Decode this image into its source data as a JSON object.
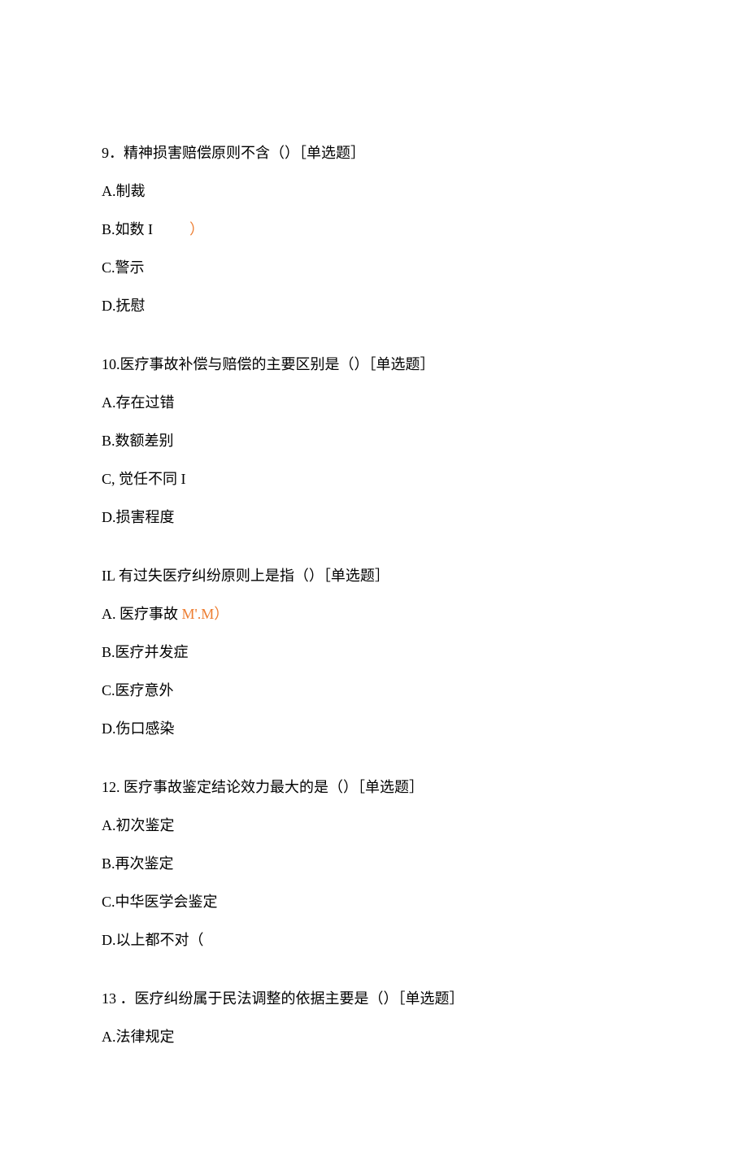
{
  "questions": [
    {
      "number": "9",
      "stem": "．精神损害赔偿原则不含（）［单选题］",
      "options": [
        {
          "prefix": "A.",
          "label": "制裁",
          "suffix": ""
        },
        {
          "prefix": "B.",
          "label": "如数 I",
          "suffix": "）"
        },
        {
          "prefix": "C.",
          "label": "警示",
          "suffix": ""
        },
        {
          "prefix": "D.",
          "label": "抚慰",
          "suffix": ""
        }
      ]
    },
    {
      "number": "10.",
      "stem": "医疗事故补偿与赔偿的主要区别是（）［单选题］",
      "options": [
        {
          "prefix": "A.",
          "label": "存在过错",
          "suffix": ""
        },
        {
          "prefix": "B.",
          "label": "数额差别",
          "suffix": ""
        },
        {
          "prefix": "C,",
          "label": " 觉任不同 I",
          "suffix": ""
        },
        {
          "prefix": "D.",
          "label": "损害程度",
          "suffix": ""
        }
      ]
    },
    {
      "number": "IL",
      "stem": " 有过失医疗纠纷原则上是指（）［单选题］",
      "options": [
        {
          "prefix": "A.",
          "label": " 医疗事故 ",
          "suffix": "M'.M）"
        },
        {
          "prefix": "B.",
          "label": "医疗并发症",
          "suffix": ""
        },
        {
          "prefix": "C.",
          "label": "医疗意外",
          "suffix": ""
        },
        {
          "prefix": "D.",
          "label": "伤口感染",
          "suffix": ""
        }
      ]
    },
    {
      "number": "12.",
      "stem": " 医疗事故鉴定结论效力最大的是（）［单选题］",
      "options": [
        {
          "prefix": "A.",
          "label": "初次鉴定",
          "suffix": ""
        },
        {
          "prefix": "B.",
          "label": "再次鉴定",
          "suffix": ""
        },
        {
          "prefix": "C.",
          "label": "中华医学会鉴定",
          "suffix": ""
        },
        {
          "prefix": "D.",
          "label": "以上都不对（",
          "suffix": ""
        }
      ]
    },
    {
      "number": "13",
      "stem": " ．医疗纠纷属于民法调整的依据主要是（）［单选题］",
      "options": [
        {
          "prefix": "A.",
          "label": "法律规定",
          "suffix": ""
        }
      ]
    }
  ]
}
